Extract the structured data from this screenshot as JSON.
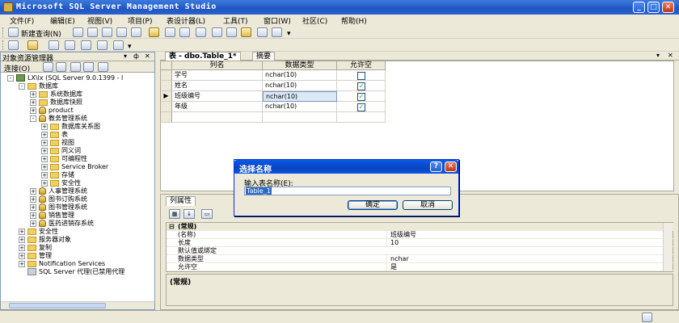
{
  "window": {
    "title": "Microsoft SQL Server Management Studio"
  },
  "menu": [
    "文件(F)",
    "编辑(E)",
    "视图(V)",
    "项目(P)",
    "表设计器(L)",
    "工具(T)",
    "窗口(W)",
    "社区(C)",
    "帮助(H)"
  ],
  "toolbar": {
    "new_query": "新建查询(N)"
  },
  "object_explorer": {
    "title": "对象资源管理器",
    "connect": "连接(O)",
    "tree": [
      {
        "level": 0,
        "exp": "-",
        "icon": "srv",
        "label": "LX\\lx (SQL Server 9.0.1399 - l"
      },
      {
        "level": 1,
        "exp": "-",
        "icon": "fld",
        "label": "数据库"
      },
      {
        "level": 2,
        "exp": "+",
        "icon": "fld",
        "label": "系统数据库"
      },
      {
        "level": 2,
        "exp": "+",
        "icon": "fld",
        "label": "数据库快照"
      },
      {
        "level": 2,
        "exp": "+",
        "icon": "db",
        "label": "product"
      },
      {
        "level": 2,
        "exp": "-",
        "icon": "db",
        "label": "教务管理系统"
      },
      {
        "level": 3,
        "exp": "+",
        "icon": "fld",
        "label": "数据库关系图"
      },
      {
        "level": 3,
        "exp": "+",
        "icon": "fld",
        "label": "表"
      },
      {
        "level": 3,
        "exp": "+",
        "icon": "fld",
        "label": "视图"
      },
      {
        "level": 3,
        "exp": "+",
        "icon": "fld",
        "label": "同义词"
      },
      {
        "level": 3,
        "exp": "+",
        "icon": "fld",
        "label": "可编程性"
      },
      {
        "level": 3,
        "exp": "+",
        "icon": "fld",
        "label": "Service Broker"
      },
      {
        "level": 3,
        "exp": "+",
        "icon": "fld",
        "label": "存储"
      },
      {
        "level": 3,
        "exp": "+",
        "icon": "fld",
        "label": "安全性"
      },
      {
        "level": 2,
        "exp": "+",
        "icon": "db",
        "label": "人事管理系统"
      },
      {
        "level": 2,
        "exp": "+",
        "icon": "db",
        "label": "图书订购系统"
      },
      {
        "level": 2,
        "exp": "+",
        "icon": "db",
        "label": "图书管理系统"
      },
      {
        "level": 2,
        "exp": "+",
        "icon": "db",
        "label": "销售管理"
      },
      {
        "level": 2,
        "exp": "+",
        "icon": "db",
        "label": "医药进销存系统"
      },
      {
        "level": 1,
        "exp": "+",
        "icon": "fld",
        "label": "安全性"
      },
      {
        "level": 1,
        "exp": "+",
        "icon": "fld",
        "label": "服务器对象"
      },
      {
        "level": 1,
        "exp": "+",
        "icon": "fld",
        "label": "复制"
      },
      {
        "level": 1,
        "exp": "+",
        "icon": "fld",
        "label": "管理"
      },
      {
        "level": 1,
        "exp": "+",
        "icon": "fld",
        "label": "Notification Services"
      },
      {
        "level": 1,
        "exp": "",
        "icon": "agent",
        "label": "SQL Server 代理(已禁用代理"
      }
    ]
  },
  "designer": {
    "tabs": [
      "表 - dbo.Table_1*",
      "摘要"
    ],
    "headers": [
      "列名",
      "数据类型",
      "允许空"
    ],
    "rows": [
      {
        "name": "学号",
        "type": "nchar(10)",
        "allow_null": false
      },
      {
        "name": "姓名",
        "type": "nchar(10)",
        "allow_null": true
      },
      {
        "name": "班级编号",
        "type": "nchar(10)",
        "allow_null": true
      },
      {
        "name": "年级",
        "type": "nchar(10)",
        "allow_null": true
      }
    ],
    "current_row_marker": "▶"
  },
  "properties": {
    "tab": "列属性",
    "rows": [
      {
        "category": true,
        "name": "(常规)",
        "value": ""
      },
      {
        "name": "(名称)",
        "value": "班级编号"
      },
      {
        "name": "长度",
        "value": "10"
      },
      {
        "name": "默认值或绑定",
        "value": ""
      },
      {
        "name": "数据类型",
        "value": "nchar"
      },
      {
        "name": "允许空",
        "value": "是"
      }
    ],
    "description_title": "(常规)"
  },
  "dialog": {
    "title": "选择名称",
    "label": "输入表名称(E):",
    "value": "Table_1",
    "ok": "确定",
    "cancel": "取消",
    "help_glyph": "?",
    "close_glyph": "✕"
  }
}
